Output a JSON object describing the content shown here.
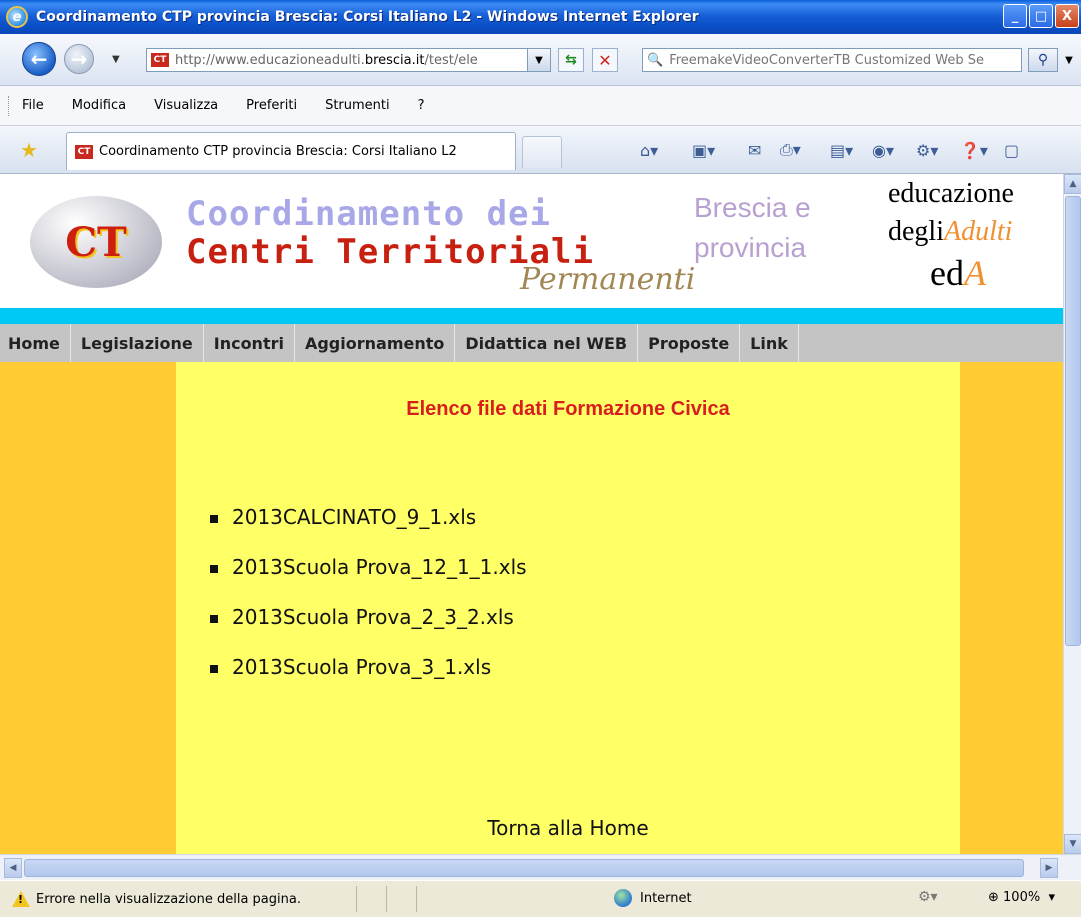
{
  "window": {
    "title": "Coordinamento CTP provincia Brescia: Corsi Italiano L2 - Windows Internet Explorer",
    "controls": {
      "minimize": "_",
      "maximize": "□",
      "close": "X"
    }
  },
  "address": {
    "url_prefix": "http://www.educazioneadulti.",
    "url_domain": "brescia.it",
    "url_suffix": "/test/ele",
    "search_placeholder": "FreemakeVideoConverterTB Customized Web Se"
  },
  "menu": [
    "File",
    "Modifica",
    "Visualizza",
    "Preferiti",
    "Strumenti",
    "?"
  ],
  "tab": {
    "label": "Coordinamento CTP provincia Brescia: Corsi Italiano L2"
  },
  "banner": {
    "logo_mark": "CT",
    "line1": "Coordinamento dei",
    "line2": "Centri Territoriali",
    "line3": "Permanenti",
    "city1": "Brescia e",
    "city2": "provincia",
    "eda1": "educazione",
    "eda2_a": "degli",
    "eda2_b": "Adulti",
    "eda3_a": "ed",
    "eda3_b": "A"
  },
  "sitenav": [
    "Home",
    "Legislazione",
    "Incontri",
    "Aggiornamento",
    "Didattica nel WEB",
    "Proposte",
    "Link"
  ],
  "main": {
    "heading": "Elenco file dati Formazione Civica",
    "files": [
      "2013CALCINATO_9_1.xls",
      "2013Scuola Prova_12_1_1.xls",
      "2013Scuola Prova_2_3_2.xls",
      "2013Scuola Prova_3_1.xls"
    ],
    "home_link": "Torna alla Home"
  },
  "status": {
    "message": "Errore nella visualizzazione della pagina.",
    "zone": "Internet",
    "zoom": "100%"
  },
  "colors": {
    "side_columns": "#ffcc33",
    "main_column": "#ffff66",
    "heading": "#d81e1e",
    "cyan_bar": "#00c8f4",
    "nav_bg": "#c4c4c4"
  }
}
